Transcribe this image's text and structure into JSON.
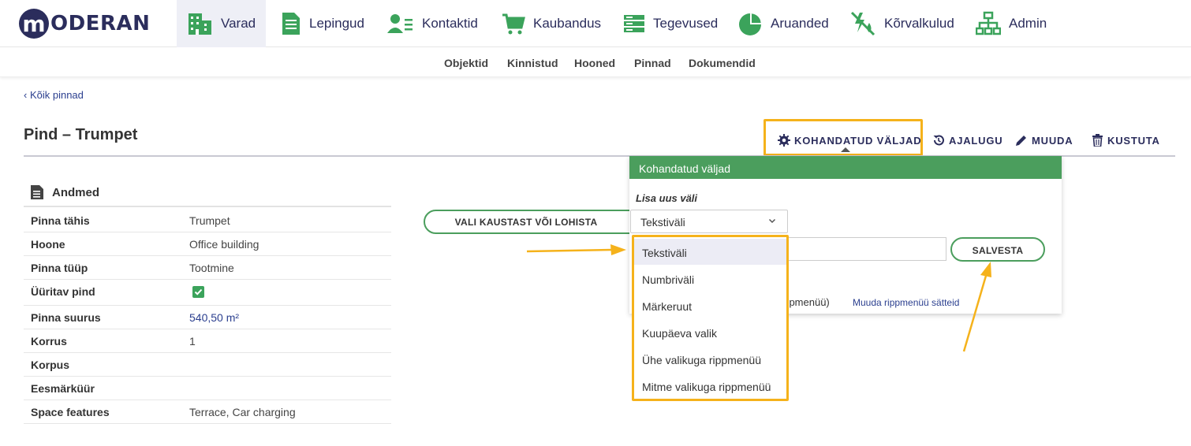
{
  "logo": {
    "letter": "m",
    "text": "ODERAN"
  },
  "nav": {
    "items": [
      {
        "label": "Varad",
        "icon": "buildings-icon"
      },
      {
        "label": "Lepingud",
        "icon": "document-icon"
      },
      {
        "label": "Kontaktid",
        "icon": "contacts-icon"
      },
      {
        "label": "Kaubandus",
        "icon": "cart-icon"
      },
      {
        "label": "Tegevused",
        "icon": "tasks-icon"
      },
      {
        "label": "Aruanded",
        "icon": "pie-chart-icon"
      },
      {
        "label": "Kõrvalkulud",
        "icon": "utilities-icon"
      },
      {
        "label": "Admin",
        "icon": "org-chart-icon"
      }
    ],
    "active": "Varad"
  },
  "subnav": {
    "items": [
      "Objektid",
      "Kinnistud",
      "Hooned",
      "Pinnad",
      "Dokumendid"
    ]
  },
  "back_link": "‹ Kõik pinnad",
  "page_title": "Pind – Trumpet",
  "actions": {
    "custom_fields": "KOHANDATUD VÄLJAD",
    "history": "AJALUGU",
    "edit": "MUUDA",
    "delete": "KUSTUTA"
  },
  "details": {
    "heading": "Andmed",
    "rows": [
      {
        "label": "Pinna tähis",
        "value": "Trumpet"
      },
      {
        "label": "Hoone",
        "value": "Office building"
      },
      {
        "label": "Pinna tüüp",
        "value": "Tootmine"
      },
      {
        "label": "Üüritav pind",
        "value": ""
      },
      {
        "label": "Pinna suurus",
        "value": "540,50 m²"
      },
      {
        "label": "Korrus",
        "value": "1"
      },
      {
        "label": "Korpus",
        "value": ""
      },
      {
        "label": "Eesmärküür",
        "value": ""
      },
      {
        "label": "Space features",
        "value": "Terrace, Car charging"
      }
    ]
  },
  "upload_button": "VALI KAUSTAST VÕI LOHISTA",
  "popup": {
    "title": "Kohandatud väljad",
    "subtitle": "Lisa uus väli",
    "select_value": "Tekstiväli",
    "save_button": "SALVESTA",
    "behind_text": "rippmenüü)",
    "edit_link": "Muuda rippmenüü sätteid"
  },
  "dropdown": {
    "options": [
      "Tekstiväli",
      "Numbriväli",
      "Märkeruut",
      "Kuupäeva valik",
      "Ühe valikuga rippmenüü",
      "Mitme valikuga rippmenüü"
    ],
    "selected": "Tekstiväli"
  },
  "colors": {
    "brand": "#2b2d5c",
    "accent_green": "#4b9e5d",
    "highlight": "#f5b21b",
    "link": "#2b3f8f"
  }
}
